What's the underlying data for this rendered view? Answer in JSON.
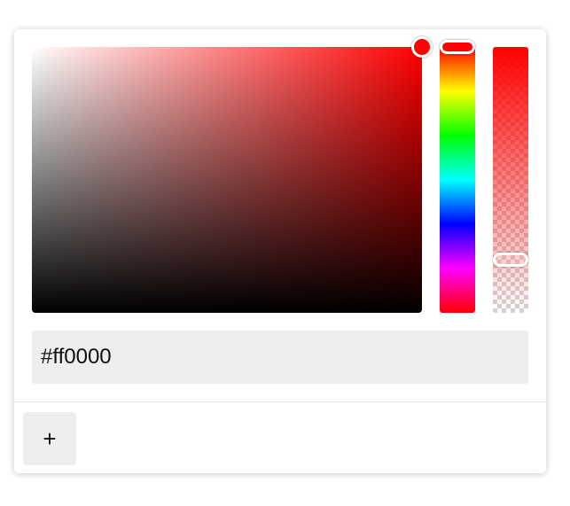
{
  "color_picker": {
    "hex_value": "#ff0000",
    "hue_color": "#ff0000",
    "selected_color": "#ff0000",
    "saturation": 1.0,
    "brightness": 1.0,
    "hue_position": 0.0,
    "alpha": 0.2,
    "add_button_label": "+"
  }
}
